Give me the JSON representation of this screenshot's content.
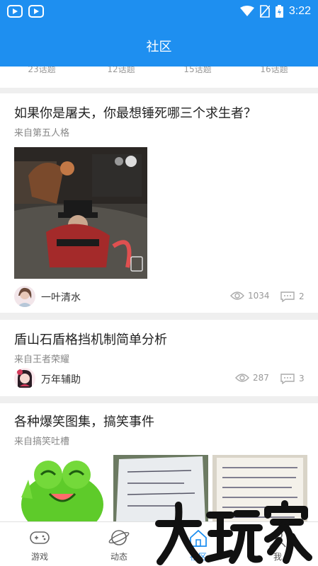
{
  "status_bar": {
    "time": "3:22",
    "icons": [
      "app-icon-1",
      "app-icon-2",
      "wifi-icon",
      "no-sim-icon",
      "battery-icon"
    ]
  },
  "header": {
    "title": "社区"
  },
  "topics": {
    "counts": [
      "23话题",
      "12话题",
      "15话题",
      "16话题"
    ]
  },
  "posts": [
    {
      "title": "如果你是屠夫，你最想锤死哪三个求生者？",
      "source": "来自第五人格",
      "author": "一叶清水",
      "views": "1034",
      "comments": "2"
    },
    {
      "title": "盾山石盾格挡机制简单分析",
      "source": "来自王者荣耀",
      "author": "万年辅助",
      "views": "287",
      "comments": "3"
    },
    {
      "title": "各种爆笑图集，搞笑事件",
      "source": "来自搞笑吐槽"
    }
  ],
  "nav": {
    "items": [
      {
        "label": "游戏",
        "icon": "gamepad-icon"
      },
      {
        "label": "动态",
        "icon": "planet-icon"
      },
      {
        "label": "社区",
        "icon": "home-icon"
      },
      {
        "label": "我",
        "icon": "profile-icon"
      }
    ],
    "active_index": 2
  },
  "watermark": {
    "text": "大玩家"
  },
  "colors": {
    "brand": "#1e8ff0",
    "background": "#efefef",
    "text": "#222222",
    "muted": "#999999"
  }
}
